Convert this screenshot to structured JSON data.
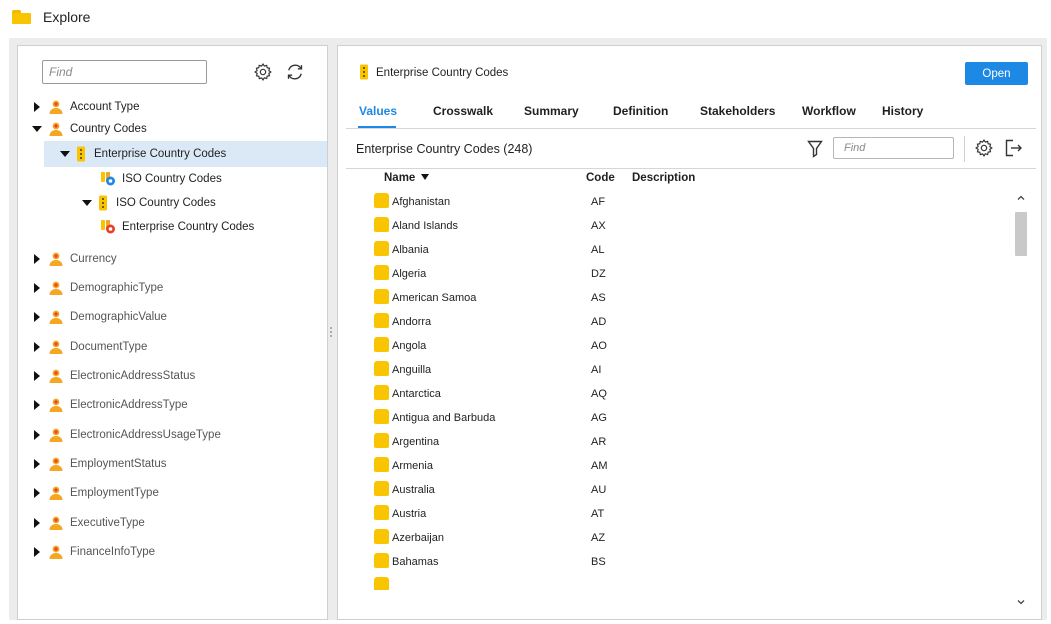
{
  "app": {
    "title": "Explore",
    "icon": "folder-icon",
    "accent_color": "#1e88e5",
    "folder_color": "#f9c400"
  },
  "tree": {
    "find_placeholder": "Find",
    "settings_icon": "gear-icon",
    "refresh_icon": "refresh-icon",
    "items": [
      {
        "label": "Account Type",
        "icon": "person-icon",
        "expanded": false
      },
      {
        "label": "Country Codes",
        "icon": "person-icon",
        "expanded": true
      },
      {
        "label": "Enterprise Country Codes",
        "icon": "entity-icon",
        "expanded": true,
        "selected": true
      },
      {
        "label": "ISO Country Codes",
        "icon": "crosswalk-icon"
      },
      {
        "label": "ISO Country Codes",
        "icon": "entity-icon",
        "expanded": true
      },
      {
        "label": "Enterprise Country Codes",
        "icon": "crosswalk-icon"
      },
      {
        "label": "Currency",
        "icon": "person-icon",
        "expanded": false
      },
      {
        "label": "DemographicType",
        "icon": "person-icon",
        "expanded": false
      },
      {
        "label": "DemographicValue",
        "icon": "person-icon",
        "expanded": false
      },
      {
        "label": "DocumentType",
        "icon": "person-icon",
        "expanded": false
      },
      {
        "label": "ElectronicAddressStatus",
        "icon": "person-icon",
        "expanded": false
      },
      {
        "label": "ElectronicAddressType",
        "icon": "person-icon",
        "expanded": false
      },
      {
        "label": "ElectronicAddressUsageType",
        "icon": "person-icon",
        "expanded": false
      },
      {
        "label": "EmploymentStatus",
        "icon": "person-icon",
        "expanded": false
      },
      {
        "label": "EmploymentType",
        "icon": "person-icon",
        "expanded": false
      },
      {
        "label": "ExecutiveType",
        "icon": "person-icon",
        "expanded": false
      },
      {
        "label": "FinanceInfoType",
        "icon": "person-icon",
        "expanded": false
      }
    ]
  },
  "detail": {
    "title": "Enterprise Country Codes",
    "open_label": "Open",
    "tabs": [
      {
        "label": "Values",
        "active": true
      },
      {
        "label": "Crosswalk"
      },
      {
        "label": "Summary"
      },
      {
        "label": "Definition"
      },
      {
        "label": "Stakeholders"
      },
      {
        "label": "Workflow"
      },
      {
        "label": "History"
      }
    ],
    "grid": {
      "title": "Enterprise Country Codes (248)",
      "find_placeholder": "Find",
      "columns": {
        "name": "Name",
        "code": "Code",
        "description": "Description"
      },
      "rows": [
        {
          "name": "Afghanistan",
          "code": "AF"
        },
        {
          "name": "Aland Islands",
          "code": "AX"
        },
        {
          "name": "Albania",
          "code": "AL"
        },
        {
          "name": "Algeria",
          "code": "DZ"
        },
        {
          "name": "American Samoa",
          "code": "AS"
        },
        {
          "name": "Andorra",
          "code": "AD"
        },
        {
          "name": "Angola",
          "code": "AO"
        },
        {
          "name": "Anguilla",
          "code": "AI"
        },
        {
          "name": "Antarctica",
          "code": "AQ"
        },
        {
          "name": "Antigua and Barbuda",
          "code": "AG"
        },
        {
          "name": "Argentina",
          "code": "AR"
        },
        {
          "name": "Armenia",
          "code": "AM"
        },
        {
          "name": "Australia",
          "code": "AU"
        },
        {
          "name": "Austria",
          "code": "AT"
        },
        {
          "name": "Azerbaijan",
          "code": "AZ"
        },
        {
          "name": "Bahamas",
          "code": "BS"
        }
      ]
    }
  }
}
